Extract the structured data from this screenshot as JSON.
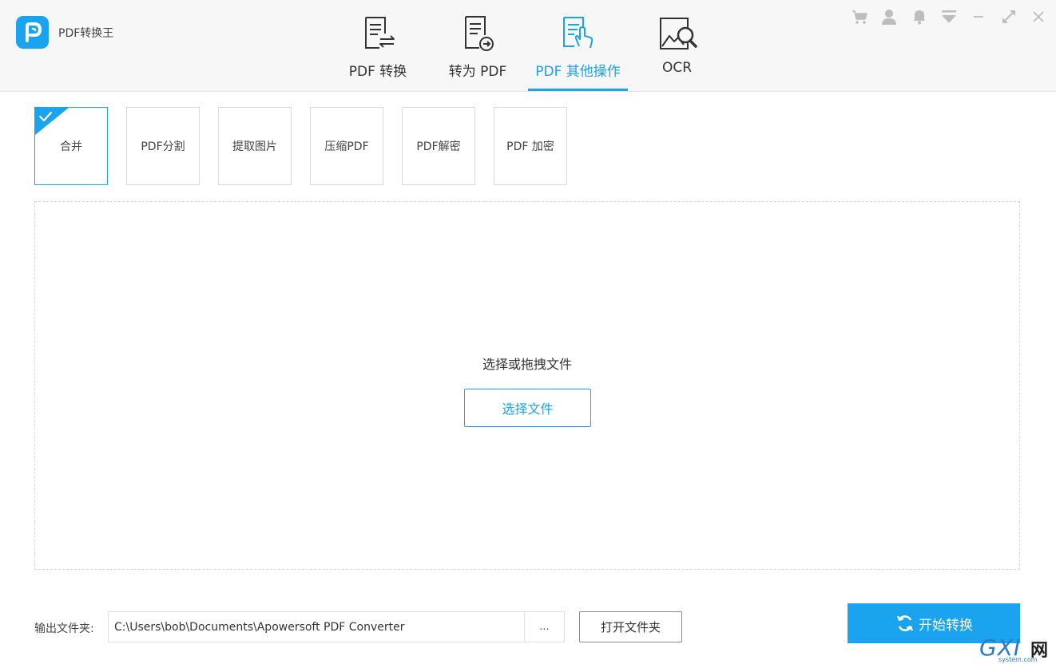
{
  "app": {
    "title": "PDF转换王"
  },
  "nav": {
    "tabs": [
      {
        "label": "PDF 转换"
      },
      {
        "label": "转为 PDF"
      },
      {
        "label": "PDF 其他操作"
      },
      {
        "label": "OCR"
      }
    ],
    "active_tab": "PDF 其他操作"
  },
  "window_controls": [
    "cart-icon",
    "user-icon",
    "bell-icon",
    "dropdown-icon",
    "minimize-icon",
    "maximize-icon",
    "close-icon"
  ],
  "operations": {
    "items": [
      {
        "label": "合并",
        "selected": true
      },
      {
        "label": "PDF分割"
      },
      {
        "label": "提取图片"
      },
      {
        "label": "压缩PDF"
      },
      {
        "label": "PDF解密"
      },
      {
        "label": "PDF 加密"
      }
    ]
  },
  "dropzone": {
    "hint": "选择或拖拽文件",
    "button_label": "选择文件"
  },
  "output": {
    "label": "输出文件夹:",
    "path": "C:\\Users\\bob\\Documents\\Apowersoft PDF Converter",
    "browse_label": "...",
    "open_folder_label": "打开文件夹"
  },
  "start_button": {
    "label": "开始转换"
  },
  "watermark": {
    "brand": "GXI",
    "brand_cn": "网",
    "site": "system.com"
  },
  "colors": {
    "accent": "#1aa3ef",
    "topbar_bg": "#f7f7f7",
    "icon_gray": "#bdbdbd"
  }
}
